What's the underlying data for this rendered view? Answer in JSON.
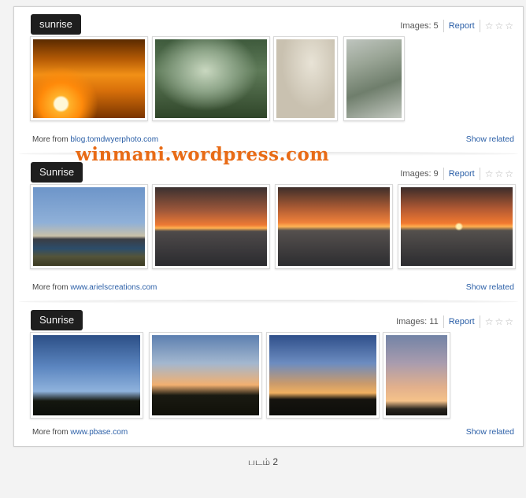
{
  "groups": [
    {
      "tag": "sunrise",
      "images_label": "Images: 5",
      "report": "Report",
      "more_prefix": "More from",
      "source": "blog.tomdwyerphoto.com",
      "related": "Show related",
      "thumbs": [
        {
          "name": "sunrise-orange-sky",
          "style": "radial-gradient(circle at 25% 82%, #fff8d8 0 6%, #ffb22a 8%, #ff8a0a 20%, transparent 35%), linear-gradient(#5a2a00, #b45a05 25%, #f29016 45%, #d8700a 65%, #7a3500 100%)"
        },
        {
          "name": "foggy-forest-road",
          "style": "radial-gradient(ellipse at 45% 40%, #c9d8c0 0%, #8fa68a 30%, transparent 60%), linear-gradient(#3e5a3c, #5e7a58 40%, #2f4529 100%)"
        },
        {
          "name": "grass-in-fog",
          "style": "radial-gradient(ellipse at 60% 30%, #e8e3d6, #c9c1b0 60%), linear-gradient(#d2ccbc, #b8ae98)"
        },
        {
          "name": "river-in-mist",
          "style": "linear-gradient(160deg, #bfc5bf 0%, #9aa596 30%, #6f7e6c 60%, #c3c8c0 100%)"
        }
      ]
    },
    {
      "tag": "Sunrise",
      "images_label": "Images: 9",
      "report": "Report",
      "more_prefix": "More from",
      "source": "www.arielscreations.com",
      "related": "Show related",
      "thumbs": [
        {
          "name": "city-skyline-dawn",
          "style": "linear-gradient(#6d95c9 0%, #8fb0d8 45%, #c8c0a8 62%, #3a3d44 66%, #2c4d6b 78%, #54543a 88%, #3b3a22 100%)"
        },
        {
          "name": "lake-sunrise-1",
          "style": "linear-gradient(#3a3030 0%, #a0583a 30%, #ee7a34 48%, #ffb252 52%, #4e4a4a 56%, #2b2b2f 100%)"
        },
        {
          "name": "lake-sunrise-2",
          "style": "linear-gradient(#3d2e2a 0%, #b35e34 28%, #f0823a 45%, #ffb455 50%, #55504e 55%, #2d2d30 100%)"
        },
        {
          "name": "lake-sunrise-3",
          "style": "radial-gradient(circle at 52% 50%, #fff0b0 0 3%, transparent 6%), linear-gradient(#3a2c2a 0%, #b45a33 28%, #f27a30 46%, #ffae4f 50%, #54504d 55%, #2c2c30 100%)"
        }
      ]
    },
    {
      "tag": "Sunrise",
      "images_label": "Images: 11",
      "report": "Report",
      "more_prefix": "More from",
      "source": "www.pbase.com",
      "related": "Show related",
      "thumbs": [
        {
          "name": "tree-silhouette-dawn",
          "style": "linear-gradient(#2c4f86 0%, #5c86c0 40%, #8fb2dc 70%, #14170f 82%, #0c0e0a 100%)"
        },
        {
          "name": "treeline-sunrise",
          "style": "linear-gradient(#5c7fb0 0%, #a3b7cf 35%, #f2b070 62%, #1a1a12 75%, #101008 100%)"
        },
        {
          "name": "clouds-sunrise",
          "style": "linear-gradient(#2f4f8a 0%, #6c8cc0 35%, #c99a6c 60%, #f0b060 72%, #15140f 80%, #0d0d0a 100%)"
        },
        {
          "name": "pastel-sky",
          "style": "linear-gradient(#7283a6 0%, #a99cae 35%, #e2b08c 65%, #f5c28a 82%, #2a2620 92%, #15130f 100%)"
        }
      ]
    }
  ],
  "watermark": "winmani.wordpress.com",
  "figure_caption": "படம் 2",
  "stars": "☆☆☆"
}
